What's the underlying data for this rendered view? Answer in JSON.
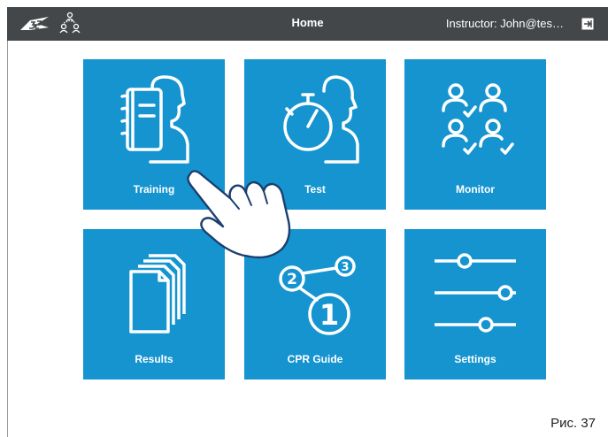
{
  "header": {
    "title": "Home",
    "instructor": "Instructor: John@tes…",
    "logo_icon": "3b-logo-icon",
    "users_icon": "users-network-icon",
    "logout_icon": "logout-icon",
    "background": "#444749"
  },
  "tiles": [
    {
      "label": "Training",
      "icon": "training-notebook-head-icon"
    },
    {
      "label": "Test",
      "icon": "stopwatch-head-icon"
    },
    {
      "label": "Monitor",
      "icon": "monitor-users-check-icon"
    },
    {
      "label": "Results",
      "icon": "documents-stack-icon"
    },
    {
      "label": "CPR Guide",
      "icon": "numbered-steps-icon"
    },
    {
      "label": "Settings",
      "icon": "sliders-icon"
    }
  ],
  "tile_color": "#1594d0",
  "overlay": {
    "icon": "pointing-hand-icon"
  },
  "caption": "Рис. 37"
}
